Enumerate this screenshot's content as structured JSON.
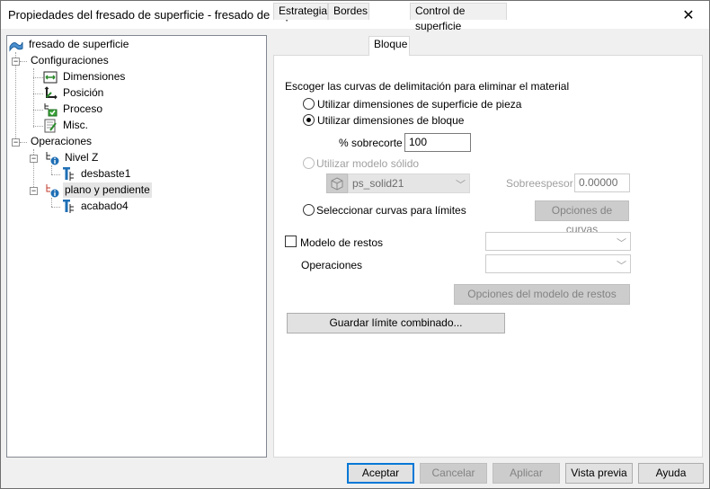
{
  "window": {
    "title": "Propiedades del fresado de superficie - fresado de superficie",
    "close_glyph": "✕"
  },
  "tree": {
    "root": "fresado de superficie",
    "configuraciones": "Configuraciones",
    "dimensiones": "Dimensiones",
    "posicion": "Posición",
    "proceso": "Proceso",
    "misc": "Misc.",
    "operaciones": "Operaciones",
    "nivel_z": "Nivel Z",
    "desbaste": "desbaste1",
    "plano": "plano y pendiente",
    "acabado": "acabado4"
  },
  "tabs": [
    "Estrategia",
    "Bordes",
    "Bloque",
    "Control de superficie"
  ],
  "panel": {
    "heading": "Escoger las curvas de delimitación para eliminar el material",
    "radio_pieza": "Utilizar dimensiones de superficie de pieza",
    "radio_bloque": "Utilizar dimensiones de bloque",
    "sobrecorte_label": "% sobrecorte",
    "sobrecorte_value": "100",
    "radio_solido": "Utilizar modelo sólido",
    "solid_combo_value": "ps_solid21",
    "sobreespesor_label": "Sobreespesor",
    "sobreespesor_value": "0.00000",
    "radio_curvas": "Seleccionar curvas para límites",
    "opciones_curvas": "Opciones de curvas",
    "modelo_restos": "Modelo de restos",
    "operaciones_label": "Operaciones",
    "opciones_restos": "Opciones del modelo de restos",
    "guardar": "Guardar límite combinado..."
  },
  "footer": {
    "aceptar": "Aceptar",
    "cancelar": "Cancelar",
    "aplicar": "Aplicar",
    "vista_previa": "Vista previa",
    "ayuda": "Ayuda"
  },
  "colors": {
    "accent": "#0078d7",
    "icon_blue": "#1f6fb5",
    "icon_green": "#2a8a2a",
    "icon_red": "#c0392b"
  }
}
